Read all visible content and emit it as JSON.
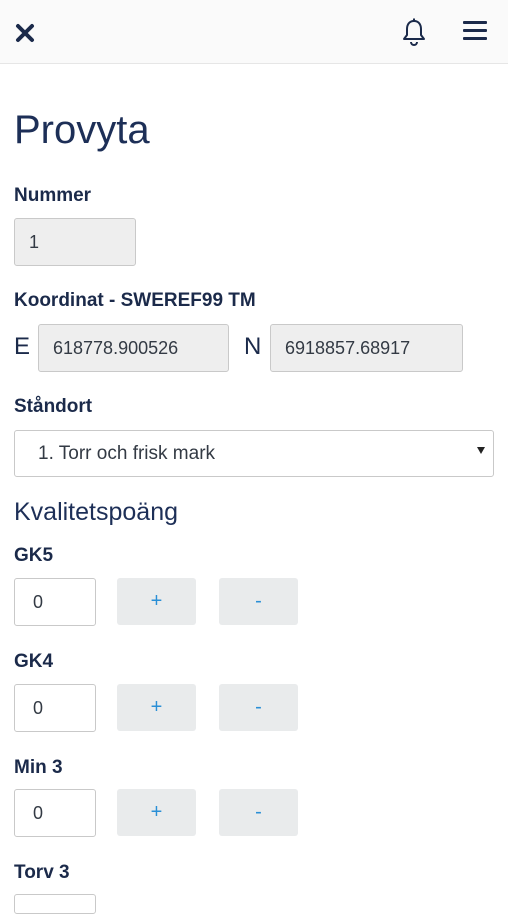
{
  "header": {
    "close_icon": "close-icon",
    "bell_icon": "bell-icon",
    "menu_icon": "hamburger-menu-icon"
  },
  "page": {
    "title": "Provyta"
  },
  "nummer": {
    "label": "Nummer",
    "value": "1"
  },
  "koordinat": {
    "label": "Koordinat - SWEREF99 TM",
    "e_label": "E",
    "e_value": "618778.900526",
    "n_label": "N",
    "n_value": "6918857.68917"
  },
  "standort": {
    "label": "Ståndort",
    "selected": "1. Torr och frisk mark"
  },
  "kvalitet": {
    "heading": "Kvalitetspoäng",
    "plus_label": "+",
    "minus_label": "-",
    "items": [
      {
        "label": "GK5",
        "value": "0"
      },
      {
        "label": "GK4",
        "value": "0"
      },
      {
        "label": "Min 3",
        "value": "0"
      },
      {
        "label": "Torv 3"
      }
    ]
  },
  "colors": {
    "title": "#1d2f57",
    "button_text": "#2a8fd6",
    "button_bg": "#e9ebec",
    "readonly_bg": "#eeeeee"
  }
}
